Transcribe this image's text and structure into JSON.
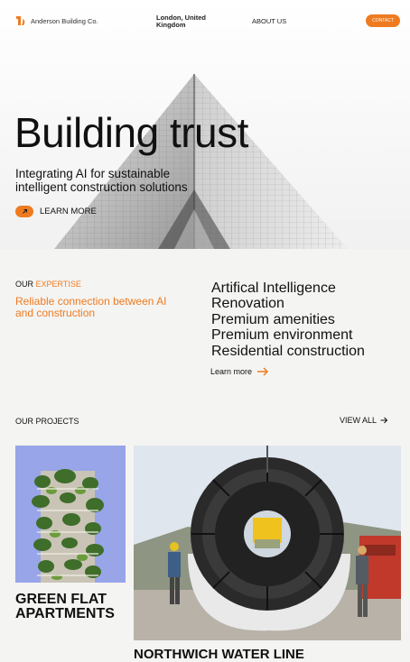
{
  "brand": {
    "name": "Anderson Building Co.",
    "accent": "#ef7b20"
  },
  "nav": {
    "location": "London, United Kingdom",
    "about": "ABOUT US",
    "contact": "CONTACT"
  },
  "hero": {
    "title": "Building trust",
    "subtitle": "Integrating AI for sustainable intelligent construction solutions",
    "cta_icon": "arrow-up-right-icon",
    "cta": "LEARN MORE"
  },
  "expertise": {
    "label_prefix": "OUR",
    "label_accent": "EXPERTISE",
    "tagline": "Reliable connection between AI and construction",
    "items": [
      "Artifical Intelligence",
      "Renovation",
      "Premium amenities",
      "Premium environment",
      "Residential construction"
    ],
    "learn_more": "Learn more"
  },
  "projects": {
    "title": "OUR PROJECTS",
    "view_all": "VIEW ALL",
    "items": [
      {
        "name": "GREEN FLAT APARTMENTS",
        "image": "vertical-forest-tower"
      },
      {
        "name": "NORTHWICH WATER LINE",
        "image": "tunnel-boring-machine"
      }
    ]
  }
}
